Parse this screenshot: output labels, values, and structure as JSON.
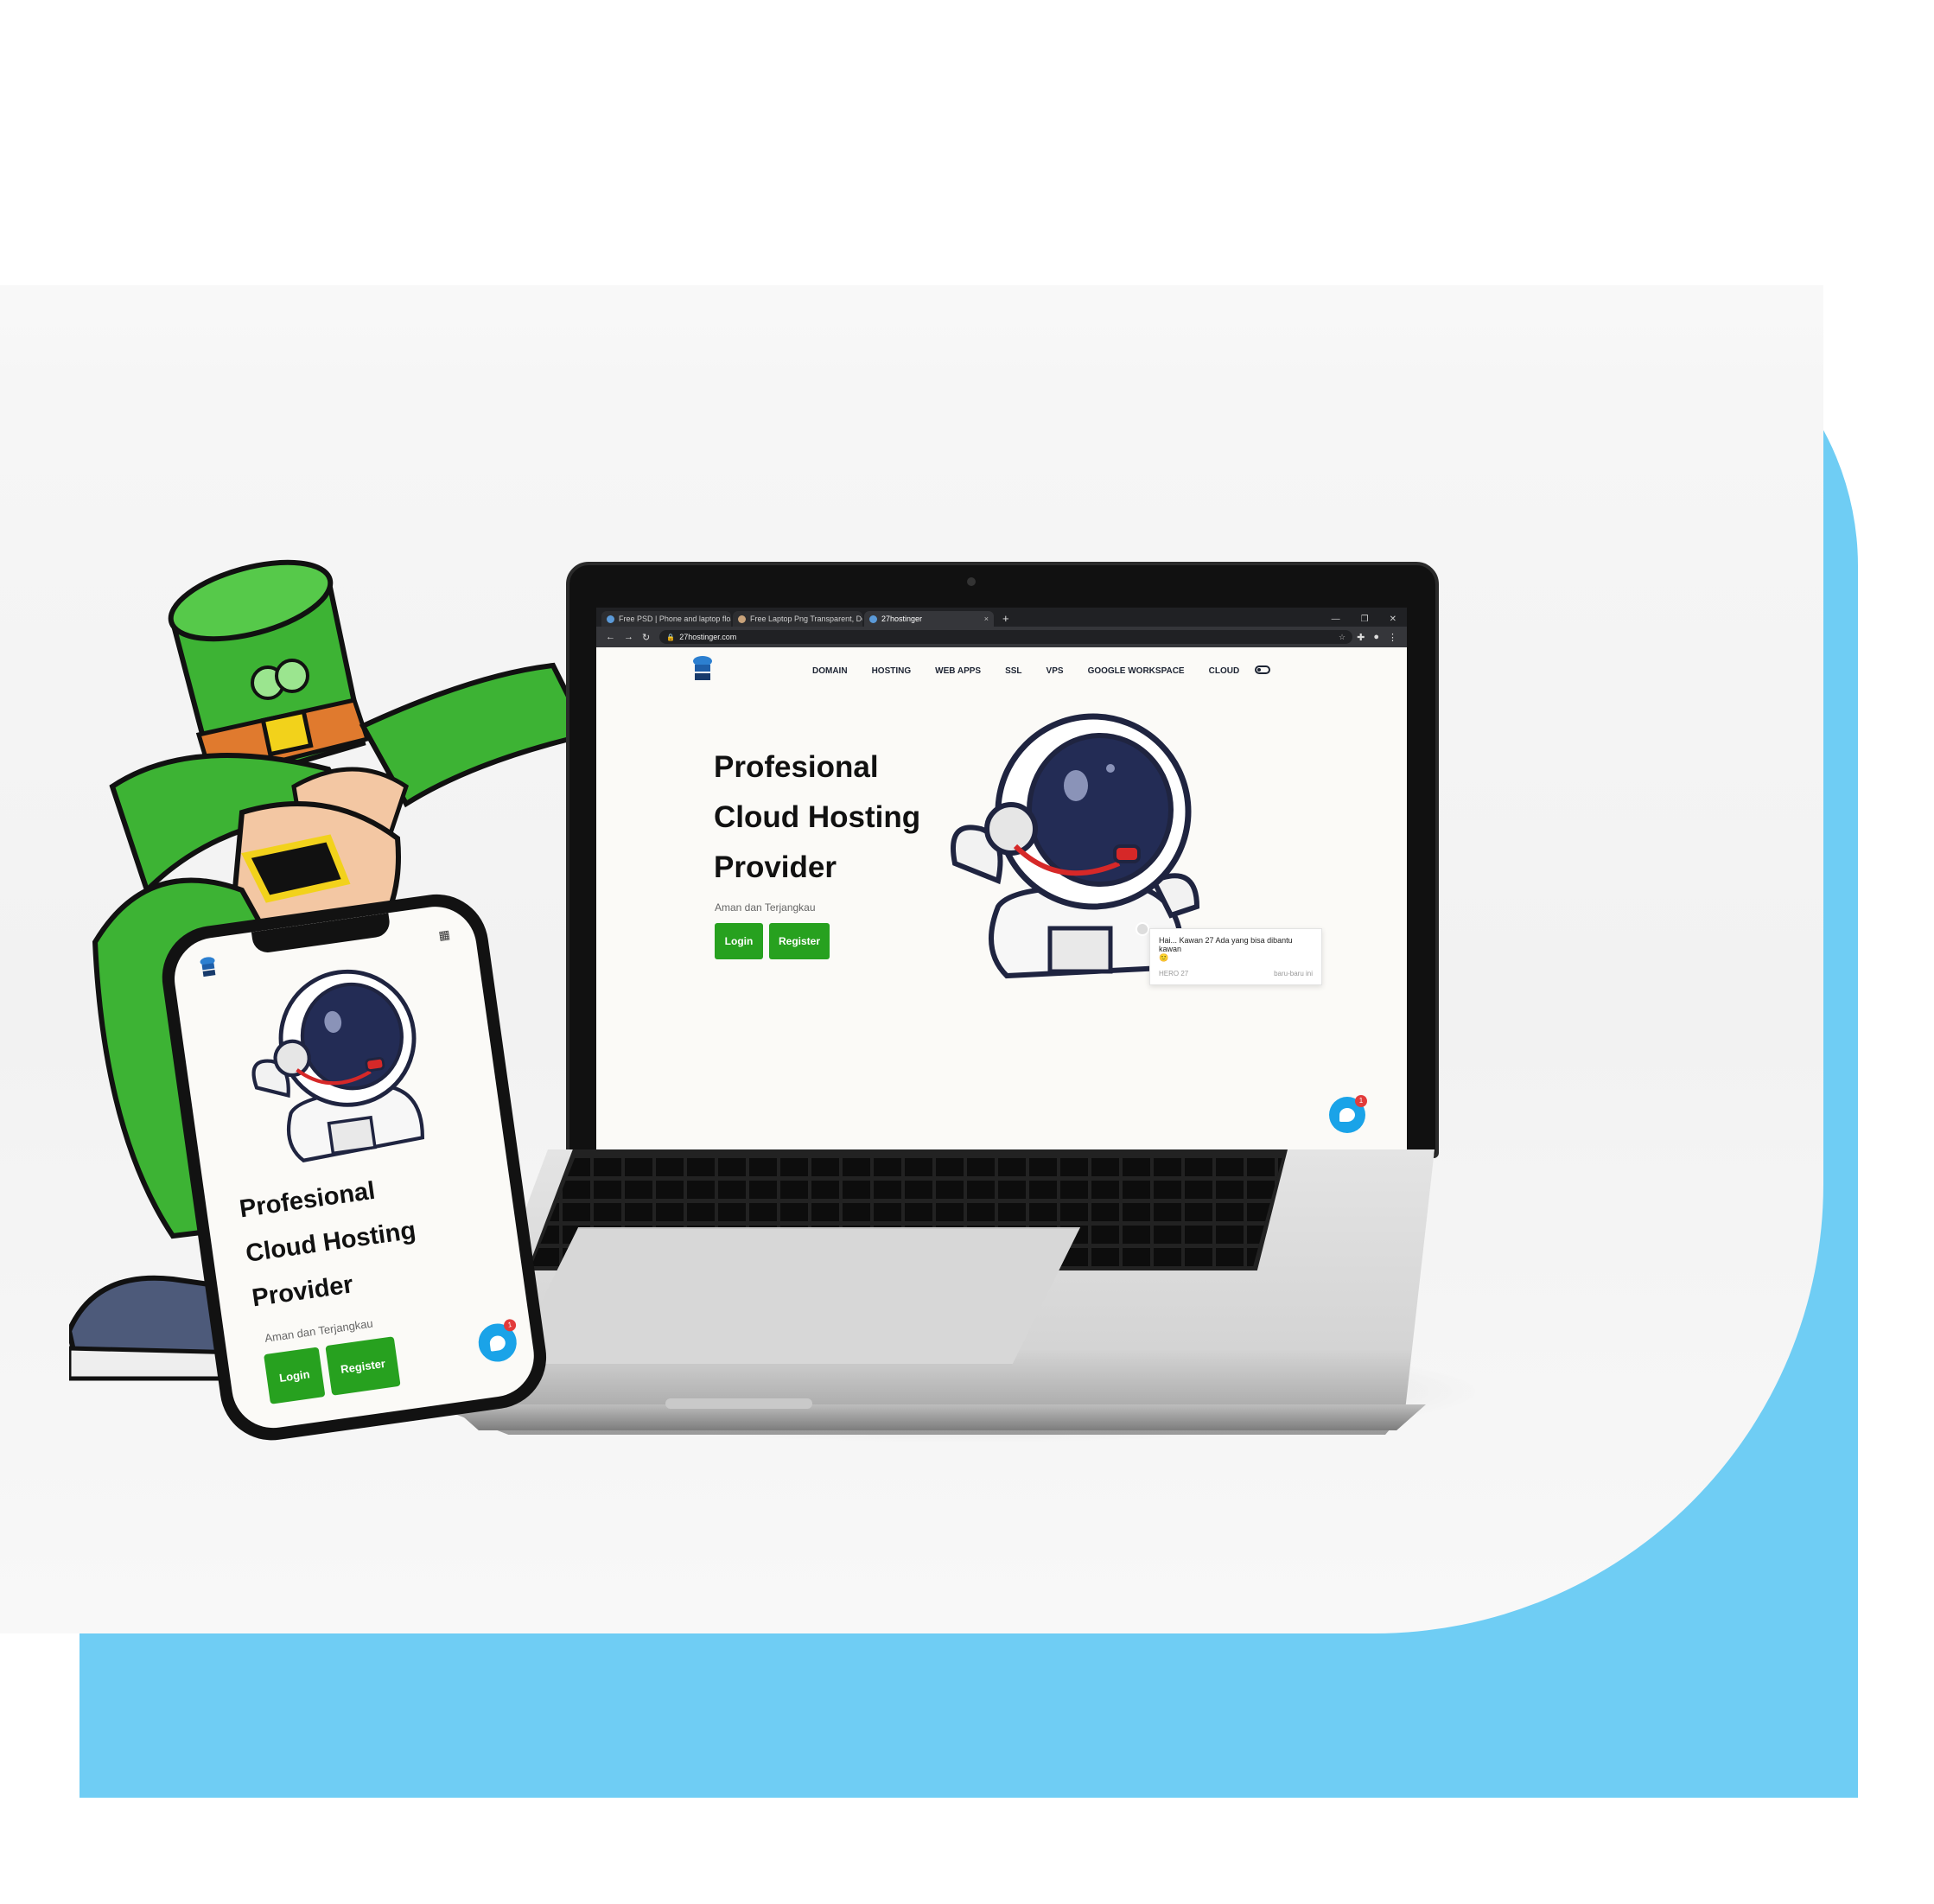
{
  "colors": {
    "accent_blue": "#6fcdf4",
    "button_green": "#27a11f",
    "chat_blue": "#1aa3e8",
    "badge_red": "#e23b3b",
    "hat_green": "#3db334",
    "beard_orange": "#d2692a"
  },
  "browser": {
    "tabs": [
      {
        "label": "Free PSD | Phone and laptop floa",
        "close": "×",
        "icon": "globe-icon"
      },
      {
        "label": "Free Laptop Png Transparent, Do",
        "close": "×",
        "icon": "page-icon"
      },
      {
        "label": "27hostinger",
        "close": "×",
        "icon": "site-favicon",
        "active": true
      }
    ],
    "new_tab": "+",
    "window_controls": [
      "—",
      "❐",
      "✕"
    ],
    "address": "27hostinger.com",
    "nav_glyphs": {
      "back": "←",
      "forward": "→",
      "reload": "↻",
      "star": "☆",
      "extensions": "✚",
      "menu": "⋮"
    }
  },
  "site": {
    "nav": [
      "DOMAIN",
      "HOSTING",
      "WEB APPS",
      "SSL",
      "VPS",
      "GOOGLE WORKSPACE",
      "CLOUD"
    ],
    "hero_title": [
      "Profesional",
      "Cloud Hosting",
      "Provider"
    ],
    "hero_subtitle": "Aman dan Terjangkau",
    "login_label": "Login",
    "register_label": "Register",
    "chat": {
      "message": "Hai... Kawan 27 Ada yang bisa dibantu kawan",
      "emoji": "🙂",
      "sender": "HERO 27",
      "time": "baru-baru ini",
      "badge_count": "1"
    }
  },
  "phone": {
    "qr_glyph": "▦",
    "hero_title": [
      "Profesional",
      "Cloud Hosting",
      "Provider"
    ],
    "hero_subtitle": "Aman dan Terjangkau",
    "login_label": "Login",
    "register_label": "Register",
    "badge_count": "1"
  }
}
